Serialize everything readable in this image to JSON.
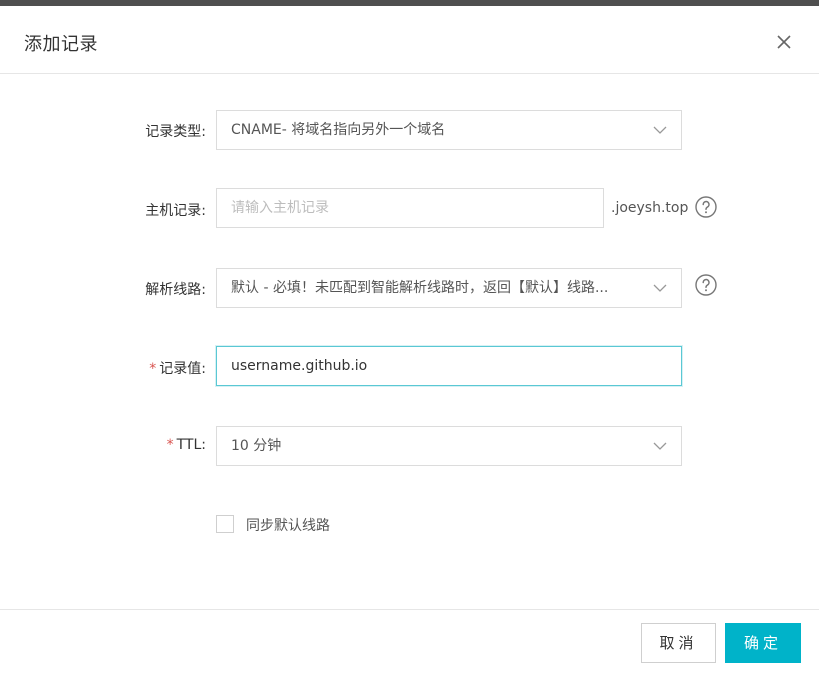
{
  "dialog": {
    "title": "添加记录",
    "close_label": "X"
  },
  "form": {
    "record_type": {
      "label": "记录类型:",
      "value": "CNAME- 将域名指向另外一个域名"
    },
    "host_record": {
      "label": "主机记录:",
      "placeholder": "请输入主机记录",
      "suffix": ".joeysh.top"
    },
    "resolution_line": {
      "label": "解析线路:",
      "value": "默认 - 必填！未匹配到智能解析线路时，返回【默认】线路..."
    },
    "record_value": {
      "required_mark": "*",
      "label": "记录值:",
      "value": "username.github.io"
    },
    "ttl": {
      "required_mark": "*",
      "label": "TTL:",
      "value": "10 分钟"
    },
    "sync_default": {
      "label": "同步默认线路",
      "checked": false
    }
  },
  "footer": {
    "cancel_label": "取消",
    "confirm_label": "确定"
  },
  "colors": {
    "primary": "#00b3c9",
    "focus_border": "#5ac8d4",
    "required": "#d9534f",
    "top_bar": "#4f4f4f"
  }
}
